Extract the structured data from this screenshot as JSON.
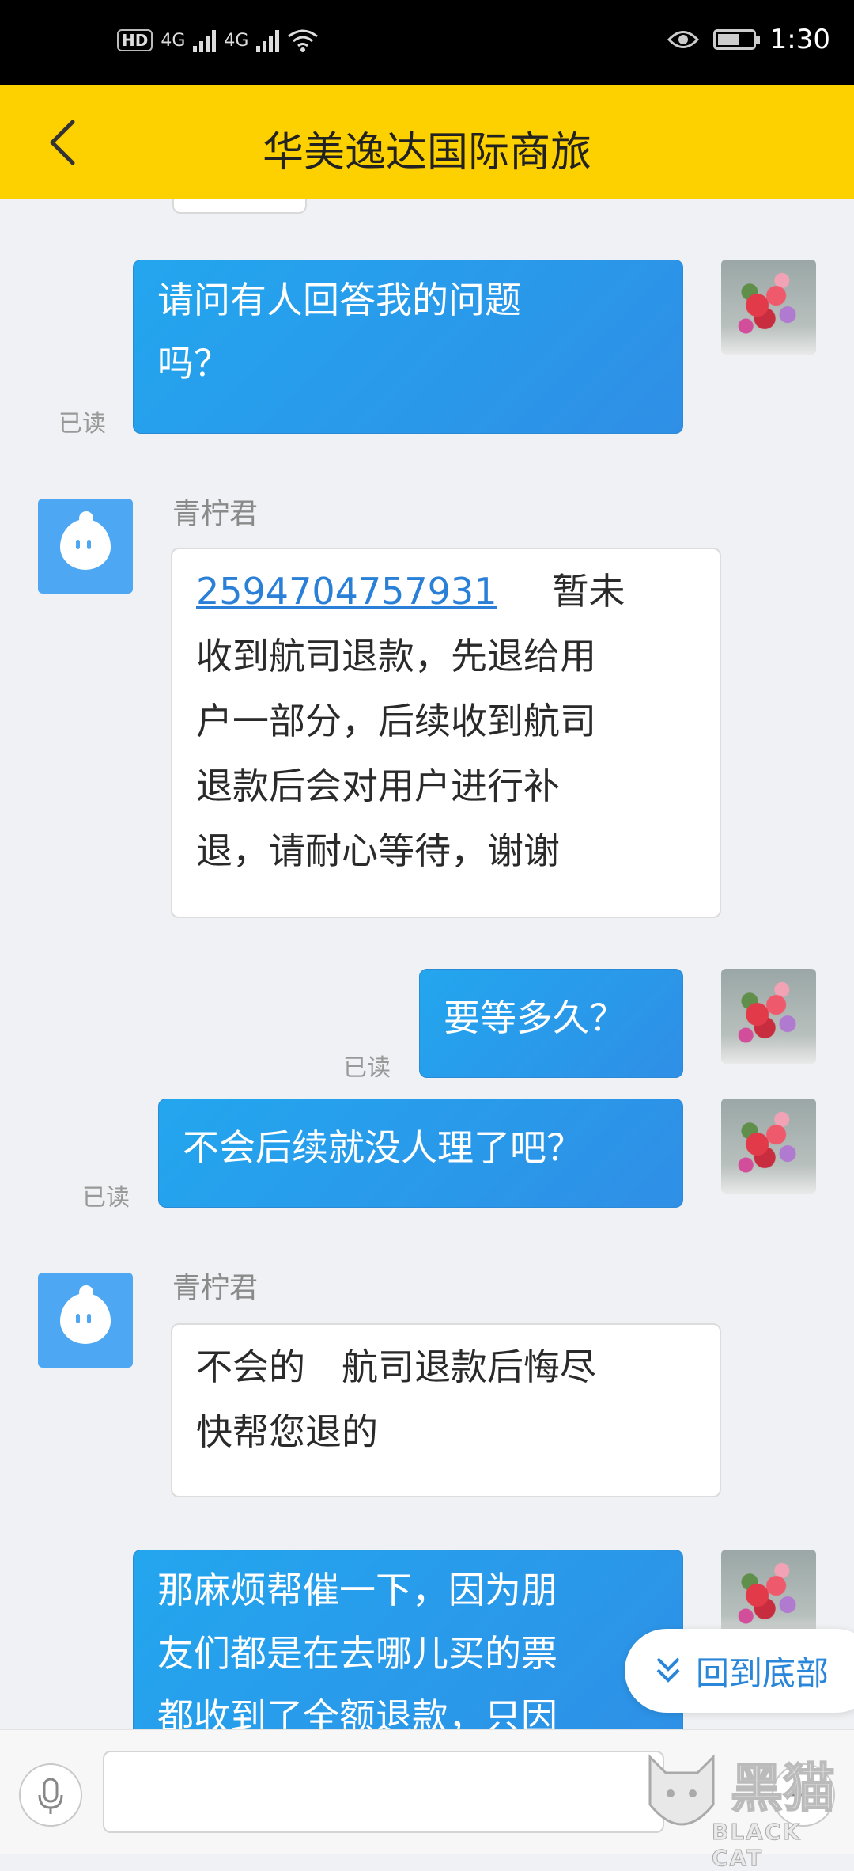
{
  "status_bar": {
    "hd": "HD",
    "net1": "4G",
    "net2": "4G",
    "time": "1:30",
    "battery_level": 0.65
  },
  "header": {
    "title": "华美逸达国际商旅"
  },
  "messages": {
    "m1": {
      "line1": "请问有人回答我的问题",
      "line2": "吗？",
      "status": "已读"
    },
    "m2": {
      "sender": "青柠君",
      "link": "2594704757931",
      "line1_rest": "暂未",
      "line2": "收到航司退款，先退给用",
      "line3": "户一部分，后续收到航司",
      "line4": "退款后会对用户进行补",
      "line5": "退，请耐心等待，谢谢"
    },
    "m3": {
      "text": "要等多久？",
      "status": "已读"
    },
    "m4": {
      "text": "不会后续就没人理了吧？",
      "status": "已读"
    },
    "m5": {
      "sender": "青柠君",
      "line1": "不会的　航司退款后悔尽",
      "line2": "快帮您退的"
    },
    "m6": {
      "line1": "那麻烦帮催一下，因为朋",
      "line2": "友们都是在去哪儿买的票",
      "line3": "都收到了全额退款，只因"
    }
  },
  "back_to_bottom": {
    "label": "回到底部"
  },
  "input": {
    "placeholder": ""
  },
  "watermark": {
    "cn": "黑猫",
    "en": "BLACK CAT"
  },
  "colors": {
    "header": "#fdd000",
    "bubble_out": "#2a9bec",
    "link": "#2a7fd6"
  }
}
